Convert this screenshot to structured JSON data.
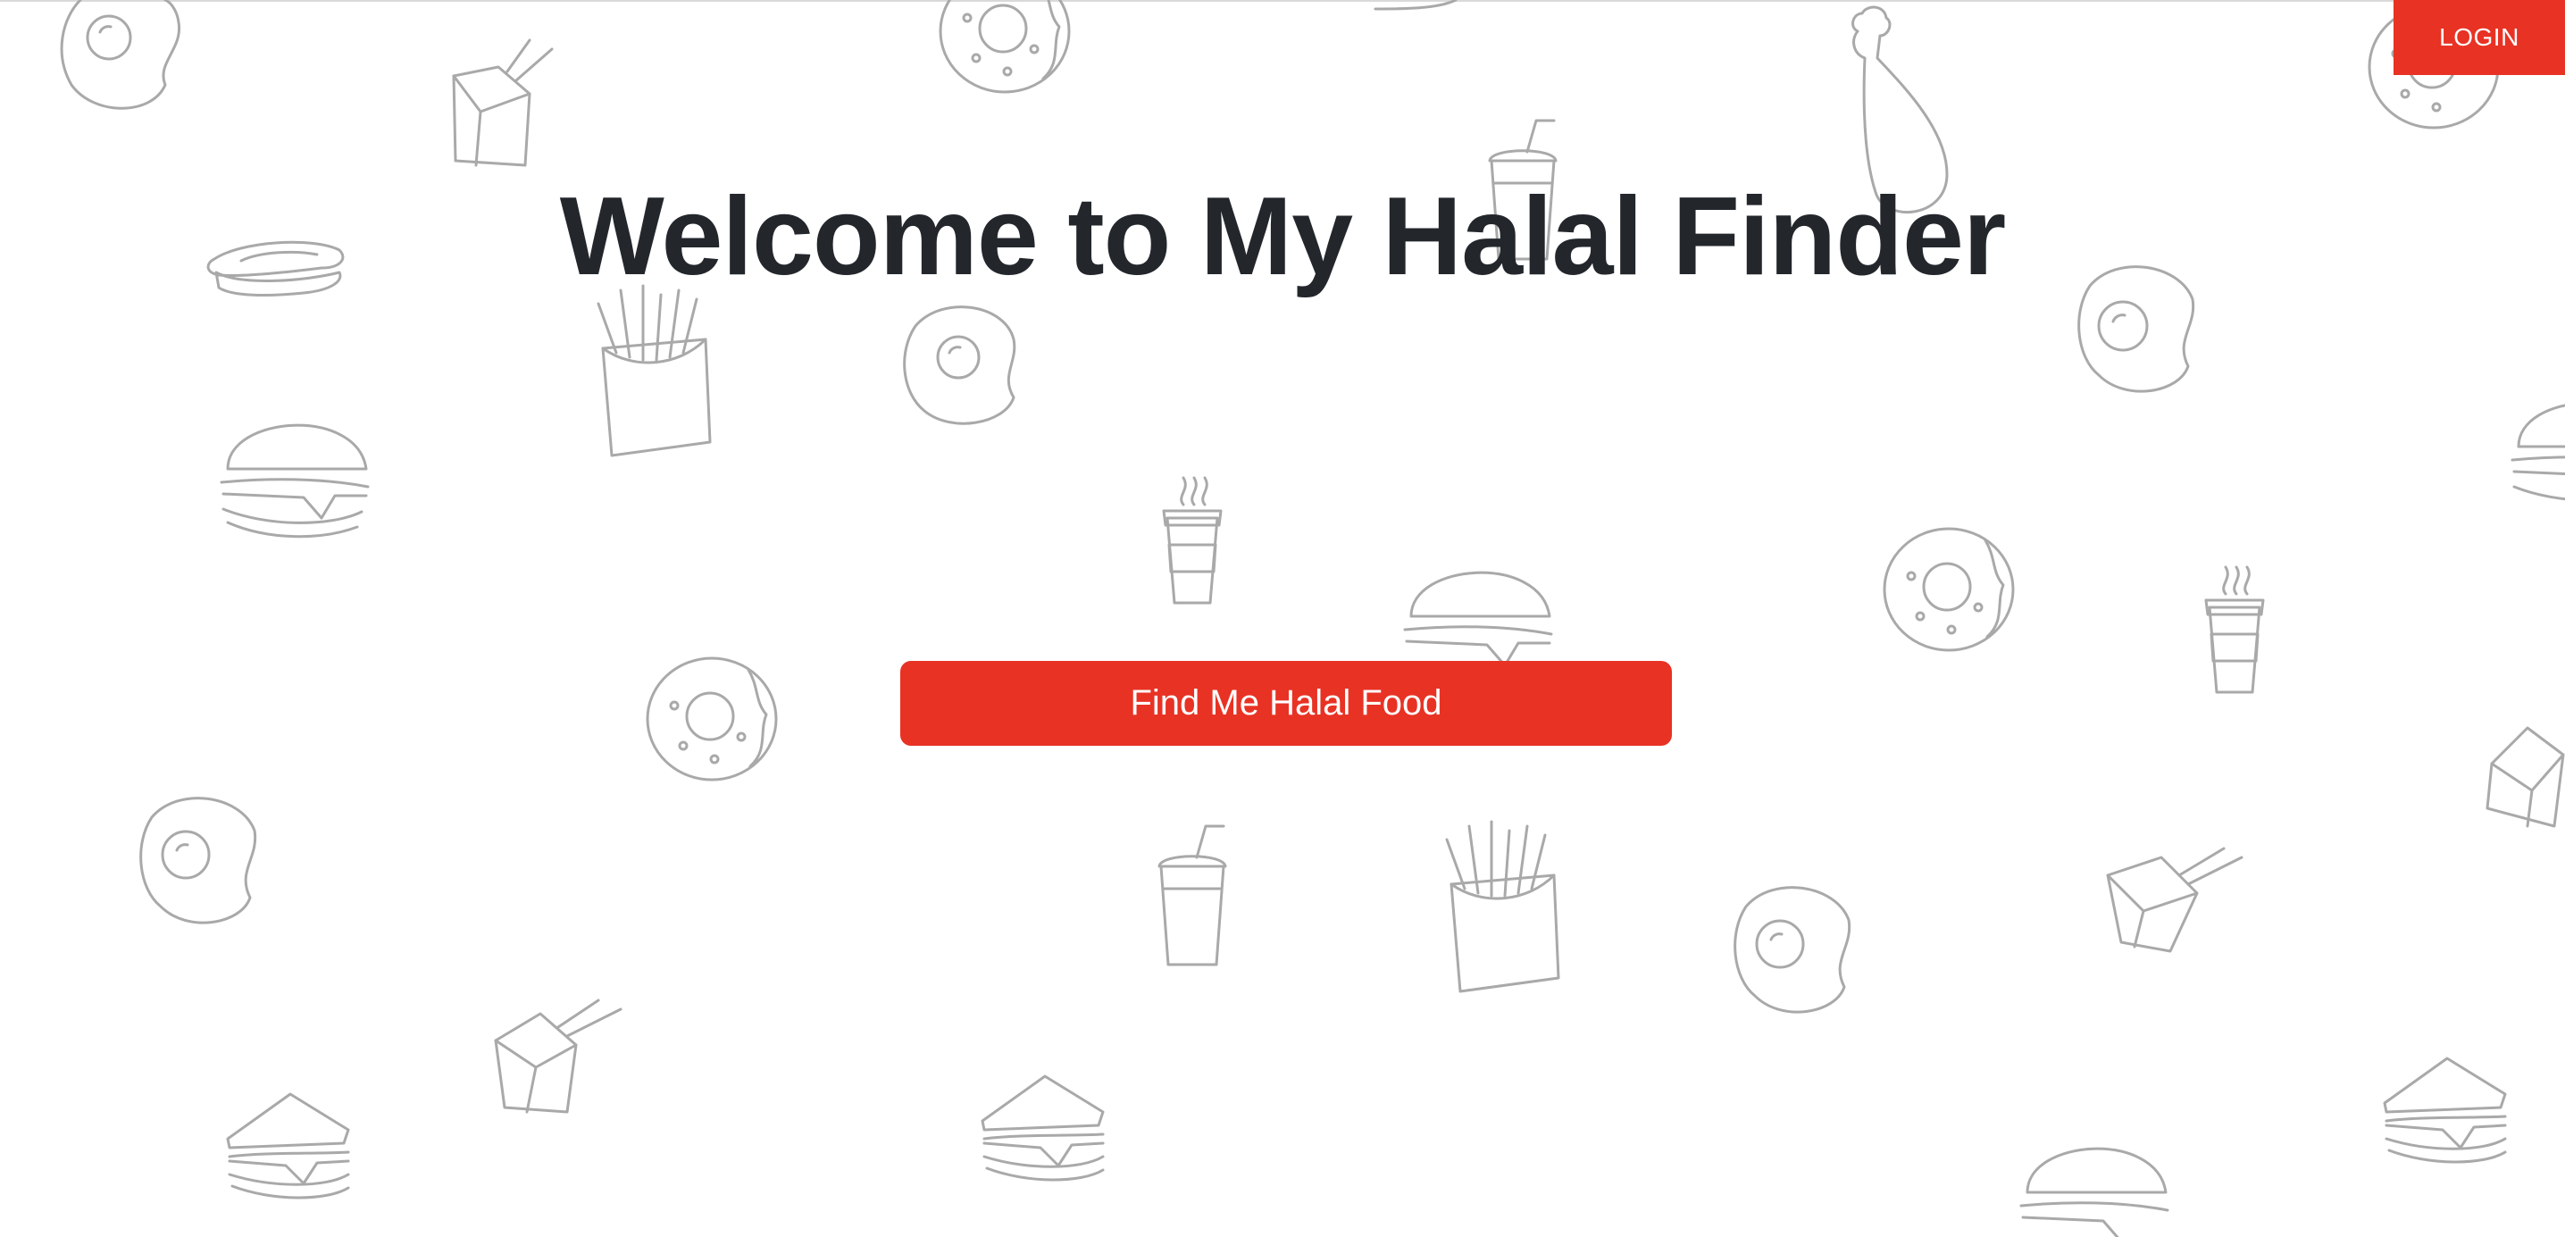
{
  "header": {
    "login_label": "LOGIN"
  },
  "hero": {
    "title": "Welcome to My Halal Finder",
    "cta_label": "Find Me Halal Food"
  },
  "colors": {
    "accent": "#e83224",
    "title_text": "#23272c",
    "doodle_stroke": "#a9a9a9",
    "background": "#ffffff"
  },
  "background_icons": [
    "fried-egg-icon",
    "donut-icon",
    "takeout-box-icon",
    "hot-dog-icon",
    "chicken-drumstick-icon",
    "soda-cup-icon",
    "french-fries-icon",
    "burger-icon",
    "coffee-cup-icon",
    "sandwich-icon"
  ]
}
